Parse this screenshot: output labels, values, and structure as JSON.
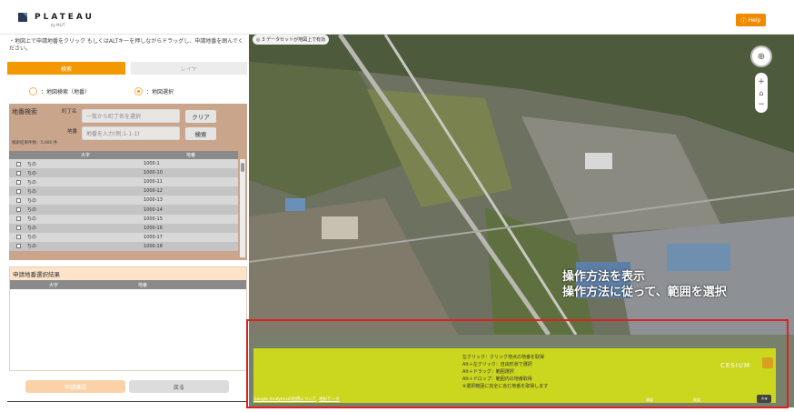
{
  "header": {
    "logo_text": "PLATEAU",
    "logo_sub": "by MLIT",
    "help_label": "Help"
  },
  "left": {
    "instruction": "・地図上で申請地番をクリック もしくはALTキーを押しながらドラッグし、申請地番を囲んでください。",
    "tabs": [
      "検索",
      "レイヤ"
    ],
    "radios": [
      "：地図検索（地番）",
      "：地図選択"
    ],
    "lot_search": {
      "title": "地番検索",
      "town_label": "町丁名",
      "town_placeholder": "一覧から町丁名を選択",
      "lot_label": "地番",
      "lot_placeholder": "地番を入力(例:1-1-1)",
      "clear_label": "クリア",
      "search_label": "検索",
      "count_text": "検索結果件数：5,000 件"
    },
    "table": {
      "columns": [
        "大字",
        "地番"
      ],
      "rows": [
        [
          "ちの",
          "1000-1"
        ],
        [
          "ちの",
          "1000-10"
        ],
        [
          "ちの",
          "1000-11"
        ],
        [
          "ちの",
          "1000-12"
        ],
        [
          "ちの",
          "1000-13"
        ],
        [
          "ちの",
          "1000-14"
        ],
        [
          "ちの",
          "1000-15"
        ],
        [
          "ちの",
          "1000-16"
        ],
        [
          "ちの",
          "1000-17"
        ],
        [
          "ちの",
          "1000-18"
        ]
      ]
    },
    "result": {
      "title": "申請地番選択結果",
      "columns": [
        "大字",
        "地番"
      ]
    },
    "buttons": {
      "confirm": "申請確認",
      "back": "戻る"
    }
  },
  "map": {
    "dataset_badge": "3 データセットが地図上で有効",
    "overlay_line1": "操作方法を表示",
    "overlay_line2": "操作方法に従って、範囲を選択",
    "help_lines": [
      "左クリック：クリック地点の地番を取得",
      "Alt＋左クリック：自由形状で選択",
      "Alt＋ドラッグ：範囲選択",
      "Alt＋ドロップ：範囲内の地番取得",
      "※選択範囲に完全に含む地番を取得します"
    ],
    "cesium_label": "CESIUM",
    "credit": "Google Analyticsの利用について",
    "credit_link": "地形データ",
    "lat_label": "緯度",
    "lon_label": "経度",
    "accent_color": "#f39800",
    "highlight_color": "#e02020"
  }
}
